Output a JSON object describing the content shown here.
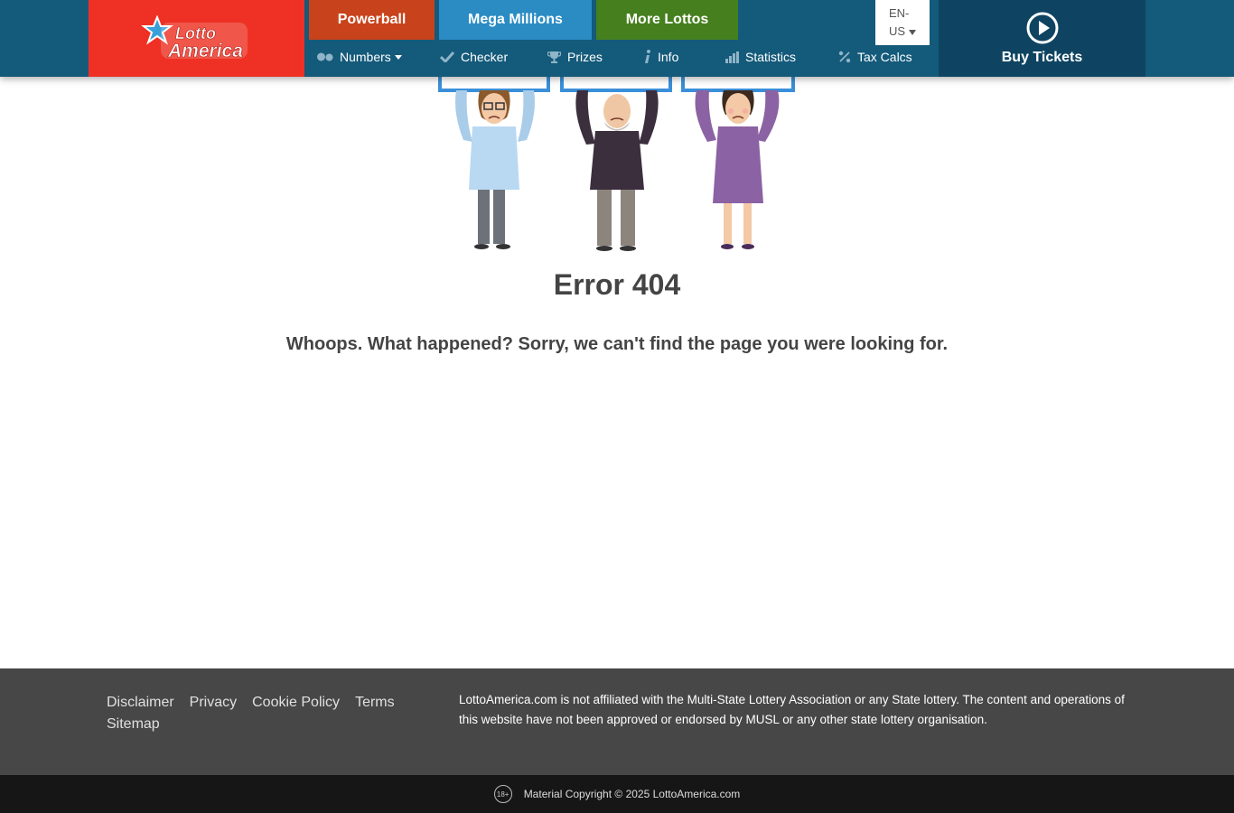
{
  "header": {
    "logo_alt": "Lotto America",
    "logo_line1": "Lotto",
    "logo_line2": "America",
    "tabs": [
      {
        "label": "Powerball"
      },
      {
        "label": "Mega Millions"
      },
      {
        "label": "More Lottos"
      }
    ],
    "language": "EN-US",
    "language_line1": "EN-",
    "language_line2": "US",
    "nav": [
      {
        "label": "Numbers",
        "icon": "balls-icon",
        "has_dropdown": true
      },
      {
        "label": "Checker",
        "icon": "checkmark-icon"
      },
      {
        "label": "Prizes",
        "icon": "trophy-icon"
      },
      {
        "label": "Info",
        "icon": "info-icon"
      },
      {
        "label": "Statistics",
        "icon": "bar-chart-icon"
      },
      {
        "label": "Tax Calcs",
        "icon": "percent-icon"
      }
    ],
    "buy_label": "Buy Tickets",
    "buy_icon": "play-circle-icon"
  },
  "main": {
    "error_title": "Error 404",
    "error_message": "Whoops. What happened? Sorry, we can't find the page you were looking for."
  },
  "footer": {
    "links": [
      "Disclaimer",
      "Privacy",
      "Cookie Policy",
      "Terms",
      "Sitemap"
    ],
    "disclaimer": "LottoAmerica.com is not affiliated with the Multi-State Lottery Association or any State lottery. The content and operations of this website have not been approved or endorsed by MUSL or any other state lottery organisation.",
    "age_badge": "18+",
    "copyright": "Material Copyright © 2025 LottoAmerica.com"
  },
  "colors": {
    "header_bg": "#145a7a",
    "logo_bg": "#ee3124",
    "powerball": "#c8431b",
    "mega_millions": "#2b8cc4",
    "more_lottos": "#46801e",
    "buy_bg": "#0e4461",
    "footer_bg": "#474747",
    "bottom_bar_bg": "#161616"
  }
}
